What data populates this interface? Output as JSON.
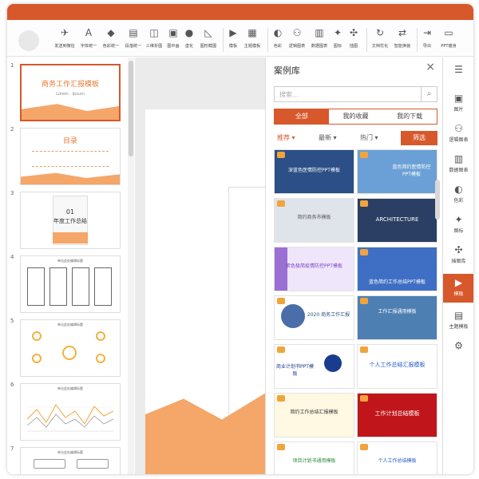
{
  "toolbar": {
    "tools": [
      {
        "label": "发送到微信",
        "icon": "send-icon"
      },
      {
        "label": "字体统一",
        "icon": "font-icon"
      },
      {
        "label": "色彩统一",
        "icon": "color-icon"
      },
      {
        "label": "段落统一",
        "icon": "paragraph-icon"
      },
      {
        "label": "三维折图",
        "icon": "fold-icon"
      },
      {
        "label": "图中画",
        "icon": "image-icon"
      },
      {
        "label": "虚化",
        "icon": "blur-icon"
      },
      {
        "label": "图形截图",
        "icon": "crop-icon"
      },
      {
        "label": "模板",
        "icon": "template-icon"
      },
      {
        "label": "主题模板",
        "icon": "theme-icon"
      },
      {
        "label": "色彩",
        "icon": "palette-icon"
      },
      {
        "label": "逻辑图表",
        "icon": "logic-icon"
      },
      {
        "label": "数据图表",
        "icon": "chart-icon"
      },
      {
        "label": "图标",
        "icon": "icon-icon"
      },
      {
        "label": "插图",
        "icon": "illustration-icon"
      },
      {
        "label": "文档优化",
        "icon": "optimize-icon"
      },
      {
        "label": "智能换装",
        "icon": "smart-icon"
      },
      {
        "label": "导出",
        "icon": "export-icon"
      },
      {
        "label": "PPT瘦身",
        "icon": "slim-icon"
      }
    ]
  },
  "thumbnails": {
    "numbers": [
      "1",
      "2",
      "3",
      "4",
      "5",
      "6",
      "7"
    ],
    "slide1_title": "商务工作汇报模板",
    "slide1_sub": "Lorem · Ipsum",
    "slide2_title": "目录",
    "slide3_num": "01",
    "slide3_title": "年度工作总结",
    "slide4_title": "单击此处编辑标题",
    "slide5_title": "单击此处编辑标题",
    "slide6_title": "单击此处编辑标题",
    "slide7_title": "单击此处编辑标题"
  },
  "panel": {
    "title": "案例库",
    "close": "×",
    "search_placeholder": "搜索...",
    "tabs": [
      "全部",
      "我的收藏",
      "我的下载"
    ],
    "filters": [
      "推荐 ▾",
      "最新 ▾",
      "热门 ▾"
    ],
    "screen_label": "筛选",
    "cards": [
      {
        "title": "深蓝色医情防控PPT模板",
        "color": "#2b4f86"
      },
      {
        "title": "蓝色简约医情防控PPT模板",
        "color": "#6aa0d6"
      },
      {
        "title": "简约商务市模板",
        "color": "#dfe4ea"
      },
      {
        "title": "ARCHITECTURE",
        "color": "#2a3f63"
      },
      {
        "title": "紫色极简疫情防控PPT模板",
        "color": "#9b6fd3"
      },
      {
        "title": "蓝色简约工作总结PPT模板",
        "color": "#3f6fc4"
      },
      {
        "title": "2020 商务工作汇报",
        "color": "#ffffff"
      },
      {
        "title": "工作汇报通用模板",
        "color": "#4d7fb3"
      },
      {
        "title": "商业计划书PPT模板",
        "color": "#ffffff"
      },
      {
        "title": "个人工作总结汇报模板",
        "color": "#ffffff"
      },
      {
        "title": "简约工作总结汇报模板",
        "color": "#fff8e3"
      },
      {
        "title": "工作计划总结模板",
        "color": "#c0161b"
      },
      {
        "title": "项目计划书通用模板",
        "color": "#ffffff"
      },
      {
        "title": "个人工作总结模板",
        "color": "#ffffff"
      }
    ]
  },
  "rightbar": {
    "items": [
      {
        "label": "",
        "icon": "menu-icon"
      },
      {
        "label": "图片",
        "icon": "picture-icon"
      },
      {
        "label": "逻辑图表",
        "icon": "logic-chart-icon"
      },
      {
        "label": "数据图表",
        "icon": "data-chart-icon"
      },
      {
        "label": "色彩",
        "icon": "color-icon"
      },
      {
        "label": "图标",
        "icon": "icons-icon"
      },
      {
        "label": "插图库",
        "icon": "windmill-icon"
      },
      {
        "label": "模板",
        "icon": "template-icon"
      },
      {
        "label": "主题模板",
        "icon": "theme-template-icon"
      },
      {
        "label": "",
        "icon": "gear-icon"
      }
    ]
  },
  "colors": {
    "accent": "#d6582b",
    "orange": "#f5a669"
  }
}
